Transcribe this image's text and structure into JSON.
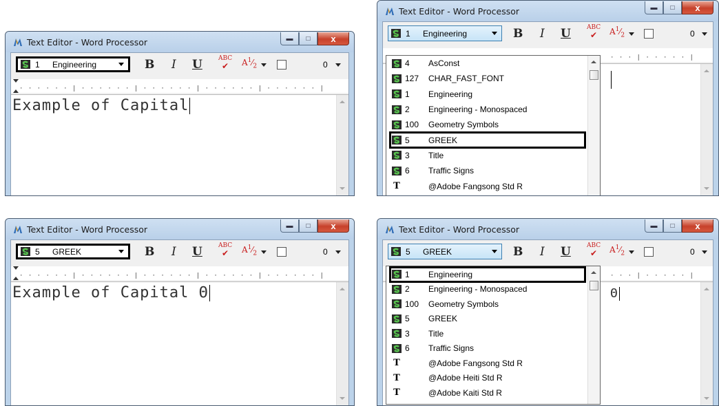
{
  "app": {
    "window_title": "Text Editor - Word Processor"
  },
  "toolbar": {
    "bold": "B",
    "italic": "I",
    "underline": "U",
    "spell": "ABC",
    "fraction_num": "1",
    "fraction_den": "2",
    "zoom": "0"
  },
  "win1": {
    "font": {
      "number": "1",
      "name": "Engineering"
    },
    "text": "Example of Capital"
  },
  "win2": {
    "font": {
      "number": "1",
      "name": "Engineering"
    },
    "list": [
      {
        "num": "4",
        "name": "AsConst",
        "icon": "font-icon"
      },
      {
        "num": "127",
        "name": "CHAR_FAST_FONT",
        "icon": "font-icon"
      },
      {
        "num": "1",
        "name": "Engineering",
        "icon": "font-icon"
      },
      {
        "num": "2",
        "name": "Engineering - Monospaced",
        "icon": "font-icon"
      },
      {
        "num": "100",
        "name": "Geometry Symbols",
        "icon": "font-icon"
      },
      {
        "num": "5",
        "name": "GREEK",
        "icon": "font-icon"
      },
      {
        "num": "3",
        "name": "Title",
        "icon": "font-icon"
      },
      {
        "num": "6",
        "name": "Traffic Signs",
        "icon": "font-icon"
      },
      {
        "num": "",
        "name": "@Adobe Fangsong Std R",
        "icon": "truetype-icon"
      }
    ],
    "selected": "GREEK"
  },
  "win3": {
    "font": {
      "number": "5",
      "name": "GREEK"
    },
    "text": "Example of Capital Θ"
  },
  "win4": {
    "font": {
      "number": "5",
      "name": "GREEK"
    },
    "text": "Θ",
    "list": [
      {
        "num": "1",
        "name": "Engineering",
        "icon": "font-icon"
      },
      {
        "num": "2",
        "name": "Engineering - Monospaced",
        "icon": "font-icon"
      },
      {
        "num": "100",
        "name": "Geometry Symbols",
        "icon": "font-icon"
      },
      {
        "num": "5",
        "name": "GREEK",
        "icon": "font-icon"
      },
      {
        "num": "3",
        "name": "Title",
        "icon": "font-icon"
      },
      {
        "num": "6",
        "name": "Traffic Signs",
        "icon": "font-icon"
      },
      {
        "num": "",
        "name": "@Adobe Fangsong Std R",
        "icon": "truetype-icon"
      },
      {
        "num": "",
        "name": "@Adobe Heiti Std R",
        "icon": "truetype-icon"
      },
      {
        "num": "",
        "name": "@Adobe Kaiti Std R",
        "icon": "truetype-icon"
      }
    ],
    "selected": "Engineering"
  },
  "colors": {
    "titlebar": "#bcd3ea",
    "close": "#c7412b",
    "spell": "#c81d1d",
    "highlight": "#000000"
  }
}
